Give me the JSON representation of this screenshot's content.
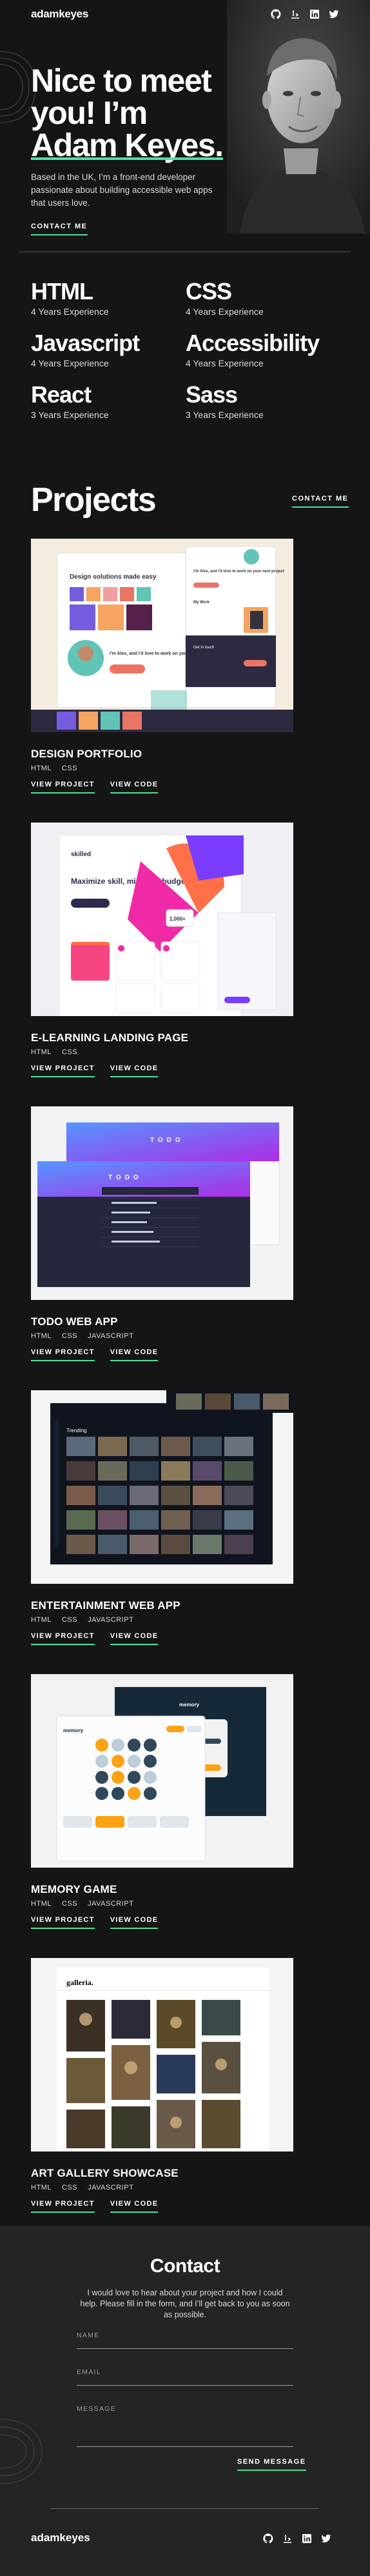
{
  "brand": {
    "logo": "adamkeyes",
    "accent": "#4ee1a0",
    "background": "#151515",
    "panel": "#242424"
  },
  "socials": [
    {
      "icon": "github-icon",
      "label": "GitHub"
    },
    {
      "icon": "frontend-mentor-icon",
      "label": "Frontend Mentor"
    },
    {
      "icon": "linkedin-icon",
      "label": "LinkedIn"
    },
    {
      "icon": "twitter-icon",
      "label": "Twitter"
    }
  ],
  "hero": {
    "title_line1": "Nice to meet",
    "title_line2": "you! I’m",
    "title_line3": "Adam Keyes.",
    "text": "Based in the UK, I’m a front-end developer passionate about building accessible web apps that users love.",
    "contact_label": "CONTACT ME"
  },
  "skills": [
    {
      "name": "HTML",
      "experience": "4 Years Experience"
    },
    {
      "name": "CSS",
      "experience": "4 Years Experience"
    },
    {
      "name": "Javascript",
      "experience": "4 Years Experience"
    },
    {
      "name": "Accessibility",
      "experience": "4 Years Experience"
    },
    {
      "name": "React",
      "experience": "3 Years Experience"
    },
    {
      "name": "Sass",
      "experience": "3 Years Experience"
    }
  ],
  "projects_section": {
    "title": "Projects",
    "contact_label": "CONTACT ME",
    "view_project_label": "VIEW PROJECT",
    "view_code_label": "VIEW CODE"
  },
  "projects": [
    {
      "title": "DESIGN PORTFOLIO",
      "tags": [
        "HTML",
        "CSS"
      ],
      "thumb_text": [
        "Design solutions made easy",
        "I'm Alex, and I'd love to work on your next project",
        "My Work",
        "Get in touch"
      ]
    },
    {
      "title": "E-LEARNING LANDING PAGE",
      "tags": [
        "HTML",
        "CSS"
      ],
      "thumb_text": [
        "skilled",
        "Maximize skill, minimize budget",
        "1,000+"
      ]
    },
    {
      "title": "TODO WEB APP",
      "tags": [
        "HTML",
        "CSS",
        "JAVASCRIPT"
      ],
      "thumb_text": [
        "TODO",
        "TODO"
      ]
    },
    {
      "title": "ENTERTAINMENT WEB APP",
      "tags": [
        "HTML",
        "CSS",
        "JAVASCRIPT"
      ],
      "thumb_text": [
        "Trending"
      ]
    },
    {
      "title": "MEMORY GAME",
      "tags": [
        "HTML",
        "CSS",
        "JAVASCRIPT"
      ],
      "thumb_text": [
        "memory",
        "memory"
      ]
    },
    {
      "title": "ART GALLERY SHOWCASE",
      "tags": [
        "HTML",
        "CSS",
        "JAVASCRIPT"
      ],
      "thumb_text": [
        "galleria."
      ]
    }
  ],
  "contact": {
    "heading": "Contact",
    "text": "I would love to hear about your project and how I could help. Please fill in the form, and I’ll get back to you as soon as possible.",
    "name_placeholder": "NAME",
    "email_placeholder": "EMAIL",
    "message_placeholder": "MESSAGE",
    "send_label": "SEND MESSAGE"
  },
  "footer": {
    "logo": "adamkeyes"
  }
}
